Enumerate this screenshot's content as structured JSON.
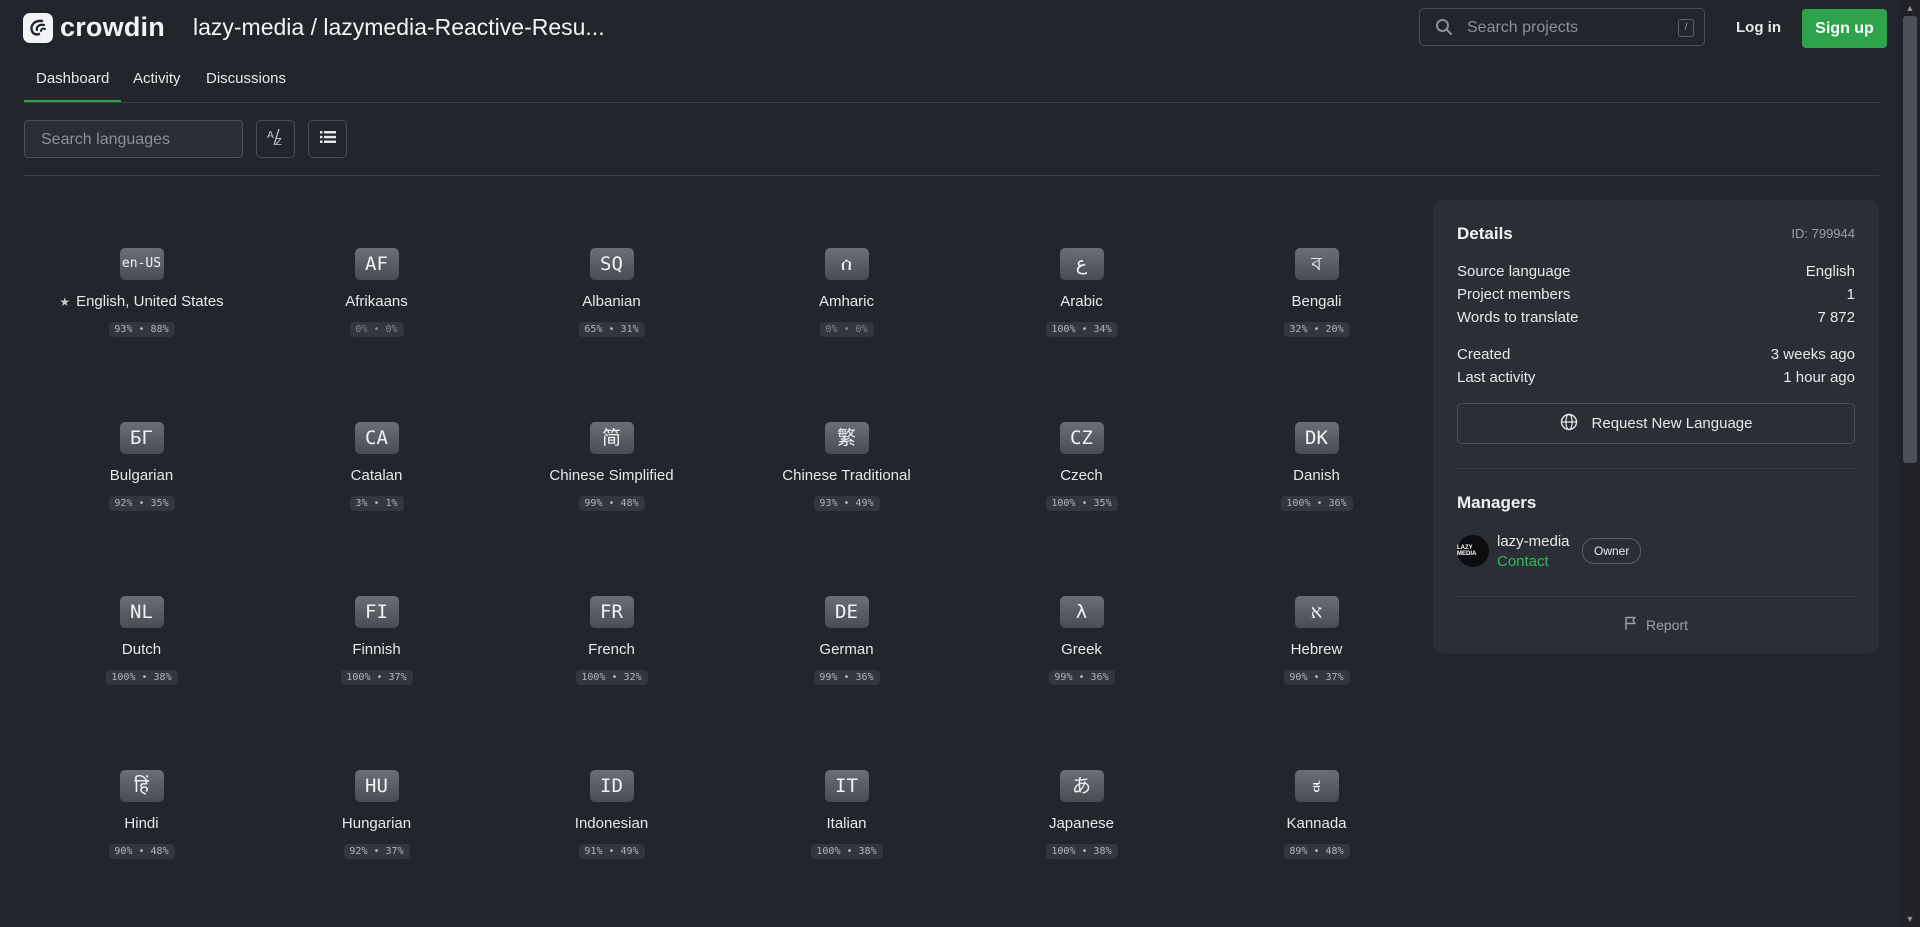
{
  "header": {
    "logo_text": "crowdin",
    "project_title": "lazy-media / lazymedia-Reactive-Resu...",
    "search_placeholder": "Search projects",
    "search_shortcut": "/",
    "login_label": "Log in",
    "signup_label": "Sign up",
    "accent_color": "#2fa34b"
  },
  "tabs": [
    {
      "label": "Dashboard",
      "active": true
    },
    {
      "label": "Activity",
      "active": false
    },
    {
      "label": "Discussions",
      "active": false
    }
  ],
  "toolbar": {
    "search_placeholder": "Search languages",
    "sort_icon": "sort-az-icon",
    "view_icon": "list-view-icon"
  },
  "languages": [
    {
      "code": "en-US",
      "name": "English, United States",
      "stats": "93% • 88%",
      "source": true
    },
    {
      "code": "AF",
      "name": "Afrikaans",
      "stats": "0% • 0%"
    },
    {
      "code": "SQ",
      "name": "Albanian",
      "stats": "65% • 31%"
    },
    {
      "code": "ሰ",
      "name": "Amharic",
      "stats": "0% • 0%"
    },
    {
      "code": "ع",
      "name": "Arabic",
      "stats": "100% • 34%"
    },
    {
      "code": "ব",
      "name": "Bengali",
      "stats": "32% • 20%"
    },
    {
      "code": "БГ",
      "name": "Bulgarian",
      "stats": "92% • 35%"
    },
    {
      "code": "CA",
      "name": "Catalan",
      "stats": "3% • 1%"
    },
    {
      "code": "简",
      "name": "Chinese Simplified",
      "stats": "99% • 48%"
    },
    {
      "code": "繁",
      "name": "Chinese Traditional",
      "stats": "93% • 49%"
    },
    {
      "code": "CZ",
      "name": "Czech",
      "stats": "100% • 35%"
    },
    {
      "code": "DK",
      "name": "Danish",
      "stats": "100% • 36%"
    },
    {
      "code": "NL",
      "name": "Dutch",
      "stats": "100% • 38%"
    },
    {
      "code": "FI",
      "name": "Finnish",
      "stats": "100% • 37%"
    },
    {
      "code": "FR",
      "name": "French",
      "stats": "100% • 32%"
    },
    {
      "code": "DE",
      "name": "German",
      "stats": "99% • 36%"
    },
    {
      "code": "λ",
      "name": "Greek",
      "stats": "99% • 36%"
    },
    {
      "code": "א",
      "name": "Hebrew",
      "stats": "90% • 37%"
    },
    {
      "code": "हिं",
      "name": "Hindi",
      "stats": "90% • 48%"
    },
    {
      "code": "HU",
      "name": "Hungarian",
      "stats": "92% • 37%"
    },
    {
      "code": "ID",
      "name": "Indonesian",
      "stats": "91% • 49%"
    },
    {
      "code": "IT",
      "name": "Italian",
      "stats": "100% • 38%"
    },
    {
      "code": "あ",
      "name": "Japanese",
      "stats": "100% • 38%"
    },
    {
      "code": "ಕ",
      "name": "Kannada",
      "stats": "89% • 48%"
    }
  ],
  "details": {
    "title": "Details",
    "id_label": "ID: 799944",
    "rows": [
      {
        "label": "Source language",
        "value": "English"
      },
      {
        "label": "Project members",
        "value": "1"
      },
      {
        "label": "Words to translate",
        "value": "7 872"
      },
      {
        "label": "Created",
        "value": "3 weeks ago"
      },
      {
        "label": "Last activity",
        "value": "1 hour ago"
      }
    ],
    "request_button": "Request New Language",
    "managers_title": "Managers",
    "manager_name": "lazy-media",
    "manager_avatar_text": "LAZY MEDIA",
    "contact_label": "Contact",
    "owner_badge": "Owner",
    "report_label": "Report"
  }
}
